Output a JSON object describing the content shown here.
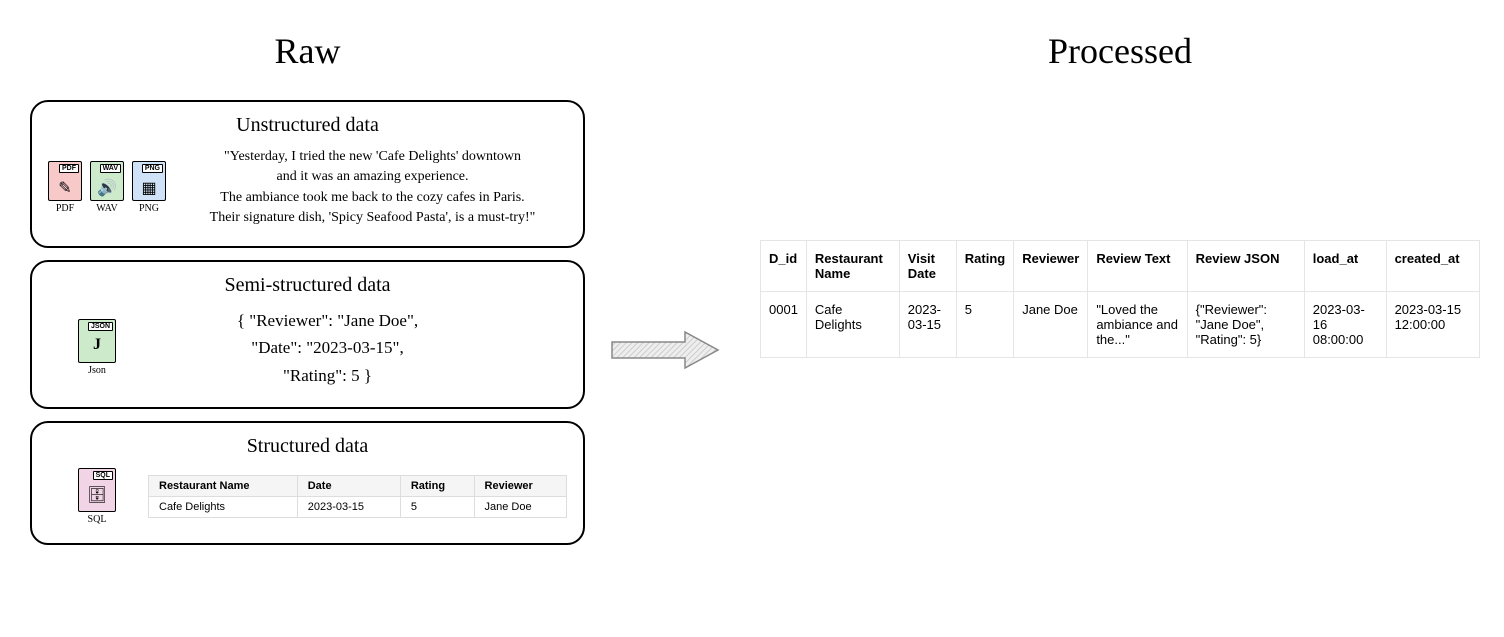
{
  "left_title": "Raw",
  "right_title": "Processed",
  "panels": {
    "unstructured": {
      "title": "Unstructured data",
      "icons": [
        {
          "name": "pdf-icon",
          "tag": "PDF",
          "label": "PDF"
        },
        {
          "name": "wav-icon",
          "tag": "WAV",
          "label": "WAV"
        },
        {
          "name": "png-icon",
          "tag": "PNG",
          "label": "PNG"
        }
      ],
      "quote_lines": [
        "\"Yesterday, I tried the new 'Cafe Delights' downtown",
        "and it was an amazing experience.",
        "The ambiance took me back to the cozy cafes in Paris.",
        "Their signature dish, 'Spicy Seafood Pasta', is a must-try!\""
      ]
    },
    "semi": {
      "title": "Semi-structured data",
      "icon": {
        "name": "json-icon",
        "tag": "JSON",
        "label": "Json"
      },
      "json_lines": [
        "{  \"Reviewer\": \"Jane Doe\",",
        "\"Date\": \"2023-03-15\",",
        "\"Rating\": 5   }"
      ]
    },
    "structured": {
      "title": "Structured data",
      "icon": {
        "name": "sql-icon",
        "tag": "SQL",
        "label": "SQL"
      },
      "table": {
        "headers": [
          "Restaurant Name",
          "Date",
          "Rating",
          "Reviewer"
        ],
        "row": [
          "Cafe Delights",
          "2023-03-15",
          "5",
          "Jane Doe"
        ]
      }
    }
  },
  "processed_table": {
    "headers": [
      "D_id",
      "Restaurant Name",
      "Visit Date",
      "Rating",
      "Reviewer",
      "Review Text",
      "Review JSON",
      "load_at",
      "created_at"
    ],
    "row": [
      "0001",
      "Cafe Delights",
      "2023-03-15",
      "5",
      "Jane Doe",
      "\"Loved the ambiance and the...\"",
      "{\"Reviewer\": \"Jane Doe\", \"Rating\": 5}",
      "2023-03-16 08:00:00",
      "2023-03-15 12:00:00"
    ]
  }
}
